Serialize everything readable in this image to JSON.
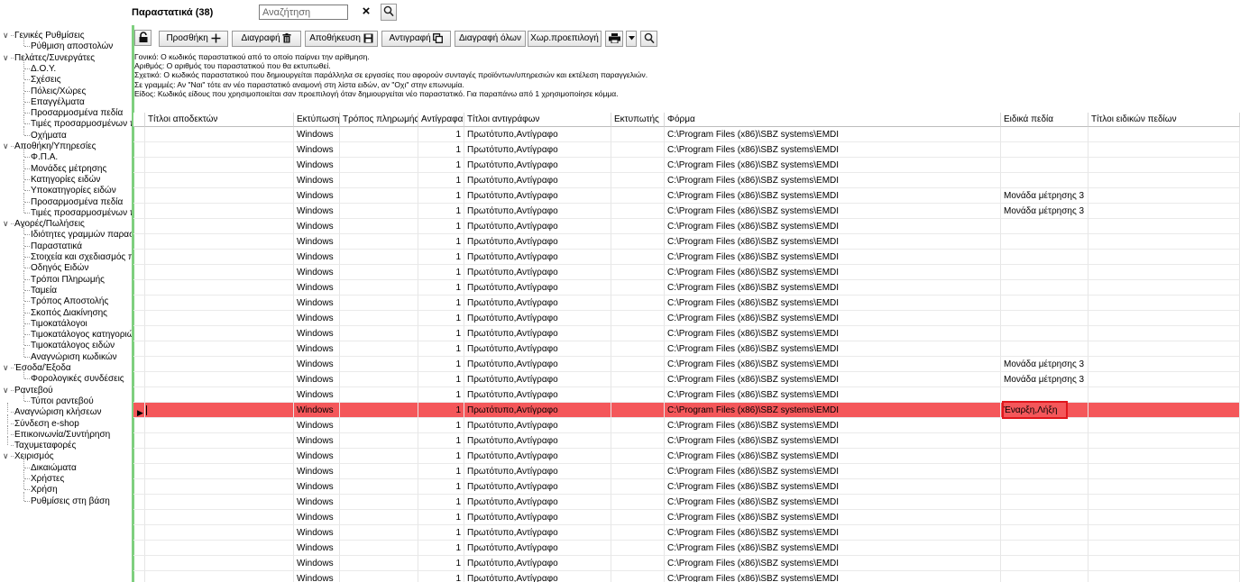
{
  "header": {
    "title": "Παραστατικά (38)",
    "search_placeholder": "Αναζήτηση",
    "clear_icon": "×"
  },
  "toolbar": {
    "lock_icon": "lock-icon",
    "add_label": "Προσθήκη",
    "delete_label": "Διαγραφή",
    "save_label": "Αποθήκευση",
    "copy_label": "Αντιγραφή",
    "delete_all_label": "Διαγραφή όλων",
    "default_label": "Χωρ.προεπιλογή"
  },
  "info_lines": [
    "Γονικό: Ο κωδικός παραστατικού από το οποίο παίρνει την αρίθμηση.",
    "Αριθμός: Ο αριθμός του παραστατικού που θα εκτυπωθεί.",
    "Σχετικό: Ο κωδικός παραστατικού που δημιουργείται παράλληλα σε εργασίες που αφορούν συνταγές προϊόντων/υπηρεσιών και εκτέλεση παραγγελιών.",
    "Σε γραμμές: Αν \"Ναι\" τότε αν νέο παραστατικό αναμονή στη λίστα ειδών, αν \"Οχι\" στην επωνυμία.",
    "Είδος: Κωδικός είδους που χρησιμοποιείται σαν προεπιλογή όταν δημιουργείται νέο παραστατικό. Για παραπάνω από 1 χρησιμοποίησε κόμμα."
  ],
  "sidebar": [
    {
      "label": "Γενικές Ρυθμίσεις",
      "level": 0,
      "expanded": true
    },
    {
      "label": "Ρύθμιση αποστολών",
      "level": 1
    },
    {
      "label": "Πελάτες/Συνεργάτες",
      "level": 0,
      "expanded": true
    },
    {
      "label": "Δ.Ο.Υ.",
      "level": 1
    },
    {
      "label": "Σχέσεις",
      "level": 1
    },
    {
      "label": "Πόλεις/Χώρες",
      "level": 1
    },
    {
      "label": "Επαγγέλματα",
      "level": 1
    },
    {
      "label": "Προσαρμοσμένα πεδία",
      "level": 1
    },
    {
      "label": "Τιμές προσαρμοσμένων π",
      "level": 1
    },
    {
      "label": "Οχήματα",
      "level": 1
    },
    {
      "label": "Αποθήκη/Υπηρεσίες",
      "level": 0,
      "expanded": true
    },
    {
      "label": "Φ.Π.Α.",
      "level": 1
    },
    {
      "label": "Μονάδες μέτρησης",
      "level": 1
    },
    {
      "label": "Κατηγορίες ειδών",
      "level": 1
    },
    {
      "label": "Υποκατηγορίες ειδών",
      "level": 1
    },
    {
      "label": "Προσαρμοσμένα πεδία",
      "level": 1
    },
    {
      "label": "Τιμές προσαρμοσμένων π",
      "level": 1
    },
    {
      "label": "Αγορές/Πωλήσεις",
      "level": 0,
      "expanded": true
    },
    {
      "label": "Ιδιότητες γραμμών παρασ",
      "level": 1
    },
    {
      "label": "Παραστατικά",
      "level": 1
    },
    {
      "label": "Στοιχεία και σχεδιασμός πα",
      "level": 1
    },
    {
      "label": "Οδηγός Ειδών",
      "level": 1
    },
    {
      "label": "Τρόποι Πληρωμής",
      "level": 1
    },
    {
      "label": "Ταμεία",
      "level": 1
    },
    {
      "label": "Τρόπος Αποστολής",
      "level": 1
    },
    {
      "label": "Σκοπός Διακίνησης",
      "level": 1
    },
    {
      "label": "Τιμοκατάλογοι",
      "level": 1
    },
    {
      "label": "Τιμοκατάλογος κατηγοριώ",
      "level": 1
    },
    {
      "label": "Τιμοκατάλογος ειδών",
      "level": 1
    },
    {
      "label": "Αναγνώριση κωδικών",
      "level": 1
    },
    {
      "label": "Έσοδα/Έξοδα",
      "level": 0,
      "expanded": true
    },
    {
      "label": "Φορολογικές συνδέσεις",
      "level": 1
    },
    {
      "label": "Ραντεβού",
      "level": 0,
      "expanded": true
    },
    {
      "label": "Τύποι ραντεβού",
      "level": 1
    },
    {
      "label": "Αναγνώριση κλήσεων",
      "level": 0
    },
    {
      "label": "Σύνδεση e-shop",
      "level": 0
    },
    {
      "label": "Επικοινωνία/Συντήρηση",
      "level": 0
    },
    {
      "label": "Ταχυμεταφορές",
      "level": 0
    },
    {
      "label": "Χειρισμός",
      "level": 0,
      "expanded": true
    },
    {
      "label": "Δικαιώματα",
      "level": 1
    },
    {
      "label": "Χρήστες",
      "level": 1
    },
    {
      "label": "Χρήση",
      "level": 1
    },
    {
      "label": "Ρυθμίσεις στη βάση",
      "level": 1
    }
  ],
  "grid": {
    "columns": [
      "Τίτλοι αποδεκτών",
      "Εκτύπωση",
      "Τρόπος πληρωμής",
      "Αντίγραφα",
      "Τίτλοι αντιγράφων",
      "Εκτυπωτής",
      "Φόρμα",
      "Ειδικά πεδία",
      "Τίτλοι ειδικών πεδίων"
    ],
    "selected_row_index": 18,
    "selected_color": "#f4575a",
    "highlight_color": "#e0161c",
    "rows": [
      {
        "print": "Windows",
        "copies": "1",
        "copy_titles": "Πρωτότυπο,Αντίγραφο",
        "form": "C:\\Program Files (x86)\\SBZ systems\\EMDI",
        "special": ""
      },
      {
        "print": "Windows",
        "copies": "1",
        "copy_titles": "Πρωτότυπο,Αντίγραφο",
        "form": "C:\\Program Files (x86)\\SBZ systems\\EMDI",
        "special": ""
      },
      {
        "print": "Windows",
        "copies": "1",
        "copy_titles": "Πρωτότυπο,Αντίγραφο",
        "form": "C:\\Program Files (x86)\\SBZ systems\\EMDI",
        "special": ""
      },
      {
        "print": "Windows",
        "copies": "1",
        "copy_titles": "Πρωτότυπο,Αντίγραφο",
        "form": "C:\\Program Files (x86)\\SBZ systems\\EMDI",
        "special": ""
      },
      {
        "print": "Windows",
        "copies": "1",
        "copy_titles": "Πρωτότυπο,Αντίγραφο",
        "form": "C:\\Program Files (x86)\\SBZ systems\\EMDI",
        "special": "Μονάδα μέτρησης 3"
      },
      {
        "print": "Windows",
        "copies": "1",
        "copy_titles": "Πρωτότυπο,Αντίγραφο",
        "form": "C:\\Program Files (x86)\\SBZ systems\\EMDI",
        "special": "Μονάδα μέτρησης 3"
      },
      {
        "print": "Windows",
        "copies": "1",
        "copy_titles": "Πρωτότυπο,Αντίγραφο",
        "form": "C:\\Program Files (x86)\\SBZ systems\\EMDI",
        "special": ""
      },
      {
        "print": "Windows",
        "copies": "1",
        "copy_titles": "Πρωτότυπο,Αντίγραφο",
        "form": "C:\\Program Files (x86)\\SBZ systems\\EMDI",
        "special": ""
      },
      {
        "print": "Windows",
        "copies": "1",
        "copy_titles": "Πρωτότυπο,Αντίγραφο",
        "form": "C:\\Program Files (x86)\\SBZ systems\\EMDI",
        "special": ""
      },
      {
        "print": "Windows",
        "copies": "1",
        "copy_titles": "Πρωτότυπο,Αντίγραφο",
        "form": "C:\\Program Files (x86)\\SBZ systems\\EMDI",
        "special": ""
      },
      {
        "print": "Windows",
        "copies": "1",
        "copy_titles": "Πρωτότυπο,Αντίγραφο",
        "form": "C:\\Program Files (x86)\\SBZ systems\\EMDI",
        "special": ""
      },
      {
        "print": "Windows",
        "copies": "1",
        "copy_titles": "Πρωτότυπο,Αντίγραφο",
        "form": "C:\\Program Files (x86)\\SBZ systems\\EMDI",
        "special": ""
      },
      {
        "print": "Windows",
        "copies": "1",
        "copy_titles": "Πρωτότυπο,Αντίγραφο",
        "form": "C:\\Program Files (x86)\\SBZ systems\\EMDI",
        "special": ""
      },
      {
        "print": "Windows",
        "copies": "1",
        "copy_titles": "Πρωτότυπο,Αντίγραφο",
        "form": "C:\\Program Files (x86)\\SBZ systems\\EMDI",
        "special": ""
      },
      {
        "print": "Windows",
        "copies": "1",
        "copy_titles": "Πρωτότυπο,Αντίγραφο",
        "form": "C:\\Program Files (x86)\\SBZ systems\\EMDI",
        "special": ""
      },
      {
        "print": "Windows",
        "copies": "1",
        "copy_titles": "Πρωτότυπο,Αντίγραφο",
        "form": "C:\\Program Files (x86)\\SBZ systems\\EMDI",
        "special": "Μονάδα μέτρησης 3"
      },
      {
        "print": "Windows",
        "copies": "1",
        "copy_titles": "Πρωτότυπο,Αντίγραφο",
        "form": "C:\\Program Files (x86)\\SBZ systems\\EMDI",
        "special": "Μονάδα μέτρησης 3"
      },
      {
        "print": "Windows",
        "copies": "1",
        "copy_titles": "Πρωτότυπο,Αντίγραφο",
        "form": "C:\\Program Files (x86)\\SBZ systems\\EMDI",
        "special": ""
      },
      {
        "print": "Windows",
        "copies": "1",
        "copy_titles": "Πρωτότυπο,Αντίγραφο",
        "form": "C:\\Program Files (x86)\\SBZ systems\\EMDI",
        "special": "Έναρξη,Λήξη"
      },
      {
        "print": "Windows",
        "copies": "1",
        "copy_titles": "Πρωτότυπο,Αντίγραφο",
        "form": "C:\\Program Files (x86)\\SBZ systems\\EMDI",
        "special": ""
      },
      {
        "print": "Windows",
        "copies": "1",
        "copy_titles": "Πρωτότυπο,Αντίγραφο",
        "form": "C:\\Program Files (x86)\\SBZ systems\\EMDI",
        "special": ""
      },
      {
        "print": "Windows",
        "copies": "1",
        "copy_titles": "Πρωτότυπο,Αντίγραφο",
        "form": "C:\\Program Files (x86)\\SBZ systems\\EMDI",
        "special": ""
      },
      {
        "print": "Windows",
        "copies": "1",
        "copy_titles": "Πρωτότυπο,Αντίγραφο",
        "form": "C:\\Program Files (x86)\\SBZ systems\\EMDI",
        "special": ""
      },
      {
        "print": "Windows",
        "copies": "1",
        "copy_titles": "Πρωτότυπο,Αντίγραφο",
        "form": "C:\\Program Files (x86)\\SBZ systems\\EMDI",
        "special": ""
      },
      {
        "print": "Windows",
        "copies": "1",
        "copy_titles": "Πρωτότυπο,Αντίγραφο",
        "form": "C:\\Program Files (x86)\\SBZ systems\\EMDI",
        "special": ""
      },
      {
        "print": "Windows",
        "copies": "1",
        "copy_titles": "Πρωτότυπο,Αντίγραφο",
        "form": "C:\\Program Files (x86)\\SBZ systems\\EMDI",
        "special": ""
      },
      {
        "print": "Windows",
        "copies": "1",
        "copy_titles": "Πρωτότυπο,Αντίγραφο",
        "form": "C:\\Program Files (x86)\\SBZ systems\\EMDI",
        "special": ""
      },
      {
        "print": "Windows",
        "copies": "1",
        "copy_titles": "Πρωτότυπο,Αντίγραφο",
        "form": "C:\\Program Files (x86)\\SBZ systems\\EMDI",
        "special": ""
      },
      {
        "print": "Windows",
        "copies": "1",
        "copy_titles": "Πρωτότυπο,Αντίγραφο",
        "form": "C:\\Program Files (x86)\\SBZ systems\\EMDI",
        "special": ""
      },
      {
        "print": "Windows",
        "copies": "1",
        "copy_titles": "Πρωτότυπο,Αντίγραφο",
        "form": "C:\\Program Files (x86)\\SBZ systems\\EMDI",
        "special": ""
      }
    ]
  }
}
